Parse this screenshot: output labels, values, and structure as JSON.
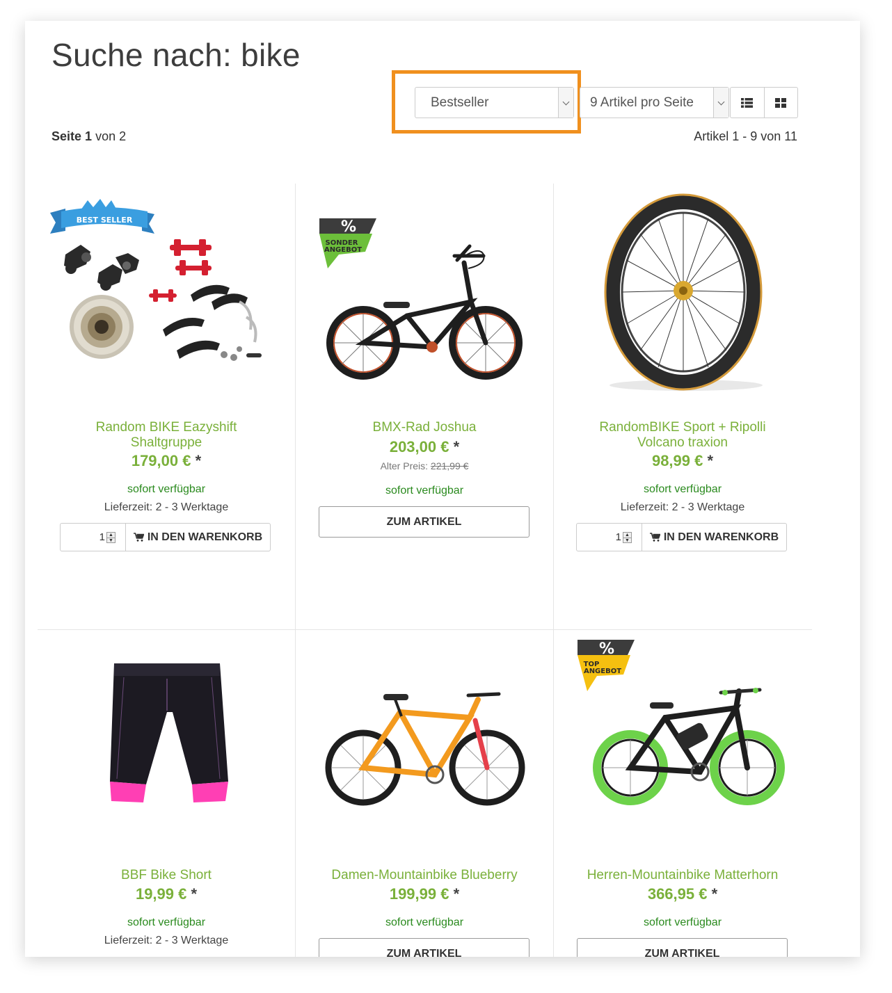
{
  "page": {
    "title": "Suche nach: bike",
    "sort": {
      "selected": "Bestseller"
    },
    "per_page": {
      "selected": "9 Artikel pro Seite"
    },
    "view_toggle": {
      "list_icon": "list-view-icon",
      "grid_icon": "grid-view-icon"
    },
    "pagination": {
      "page_label": "Seite",
      "current_page": "1",
      "of_label": "von 2"
    },
    "article_range": "Artikel 1 - 9 von 11"
  },
  "products": [
    {
      "name_line1": "Random BIKE Eazyshift",
      "name_line2": "Shaltgruppe",
      "price": "179,00 €",
      "price_star": "*",
      "availability": "sofort verfügbar",
      "delivery": "Lieferzeit: 2 - 3 Werktage",
      "quantity": "1",
      "cart_label": "IN DEN WARENKORB",
      "badge": "BEST SELLER",
      "image": "bike-parts-set"
    },
    {
      "name_line1": "BMX-Rad Joshua",
      "price": "203,00 €",
      "price_star": "*",
      "old_price_label": "Alter Preis:",
      "old_price": "221,99 €",
      "availability": "sofort verfügbar",
      "button_label": "ZUM ARTIKEL",
      "badge_symbol": "%",
      "badge_line1": "SONDER",
      "badge_line2": "ANGEBOT",
      "badge_color": "#6cbf3a",
      "image": "bmx-bike"
    },
    {
      "name_line1": "RandomBIKE Sport + Ripolli",
      "name_line2": "Volcano traxion",
      "price": "98,99 €",
      "price_star": "*",
      "availability": "sofort verfügbar",
      "delivery": "Lieferzeit: 2 - 3 Werktage",
      "quantity": "1",
      "cart_label": "IN DEN WARENKORB",
      "image": "bicycle-wheel"
    },
    {
      "name_line1": "BBF Bike Short",
      "price": "19,99 €",
      "price_star": "*",
      "availability": "sofort verfügbar",
      "delivery": "Lieferzeit: 2 - 3 Werktage",
      "image": "bike-short"
    },
    {
      "name_line1": "Damen-Mountainbike Blueberry",
      "price": "199,99 €",
      "price_star": "*",
      "availability": "sofort verfügbar",
      "button_label": "ZUM ARTIKEL",
      "image": "orange-mountainbike"
    },
    {
      "name_line1": "Herren-Mountainbike Matterhorn",
      "price": "366,95 €",
      "price_star": "*",
      "availability": "sofort verfügbar",
      "button_label": "ZUM ARTIKEL",
      "badge_symbol": "%",
      "badge_line1": "TOP",
      "badge_line2": "ANGEBOT",
      "badge_color": "#f5c010",
      "image": "e-mountainbike"
    }
  ],
  "colors": {
    "accent_green": "#7ab03a",
    "availability_green": "#2a8a1e",
    "highlight_orange": "#f0901e"
  }
}
